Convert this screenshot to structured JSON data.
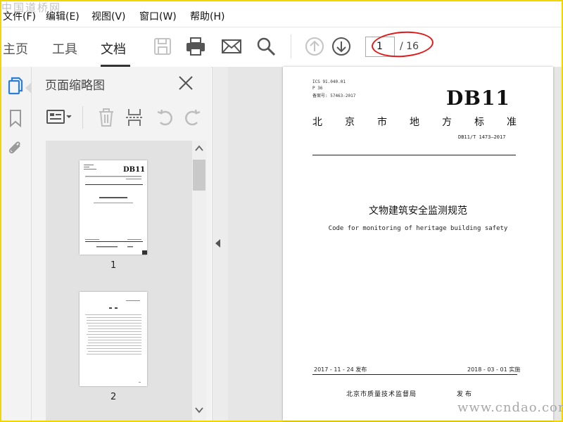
{
  "menubar": {
    "items": [
      {
        "label": "文件(F)"
      },
      {
        "label": "编辑(E)"
      },
      {
        "label": "视图(V)"
      },
      {
        "label": "窗口(W)"
      },
      {
        "label": "帮助(H)"
      }
    ]
  },
  "watermarks": {
    "top_left": "中国道桥网",
    "bottom_right": "www.cndao.com"
  },
  "toolbar": {
    "tabs": [
      {
        "label": "主页",
        "active": false
      },
      {
        "label": "工具",
        "active": false
      },
      {
        "label": "文档",
        "active": true
      }
    ],
    "icons": [
      "save-icon",
      "print-icon",
      "email-icon",
      "search-icon",
      "page-up-icon",
      "page-down-icon"
    ],
    "page_current": "1",
    "page_total": "/ 16"
  },
  "rail": {
    "icons": [
      "page-thumbnails-icon",
      "bookmarks-icon",
      "attachments-icon"
    ]
  },
  "thumbnail_panel": {
    "title": "页面缩略图",
    "tool_icons": [
      "thumbnail-options-icon",
      "delete-page-icon",
      "extract-pages-icon",
      "rotate-left-icon",
      "rotate-right-icon"
    ],
    "thumbnails": [
      {
        "page": "1"
      },
      {
        "page": "2"
      }
    ]
  },
  "document": {
    "ics": "ICS  91.040.01",
    "classification": "P 36",
    "filing_no": "备案号: 57463-2017",
    "db_mark": "DB11",
    "standard_chars": [
      "北",
      "京",
      "市",
      "地",
      "方",
      "标",
      "准"
    ],
    "std_code": "DB11/T 1473—2017",
    "title_cn": "文物建筑安全监测规范",
    "title_en": "Code for monitoring of heritage building safety",
    "issue_date": "2017 - 11 - 24 发布",
    "implement_date": "2018 - 03 - 01 实施",
    "issuer": "北京市质量技术监督局",
    "publish": "发布"
  },
  "colors": {
    "frame_border": "#f2d600",
    "annotation_oval": "#e01818",
    "icon_gray": "#555555",
    "panel_bg": "#f3f3f3"
  }
}
